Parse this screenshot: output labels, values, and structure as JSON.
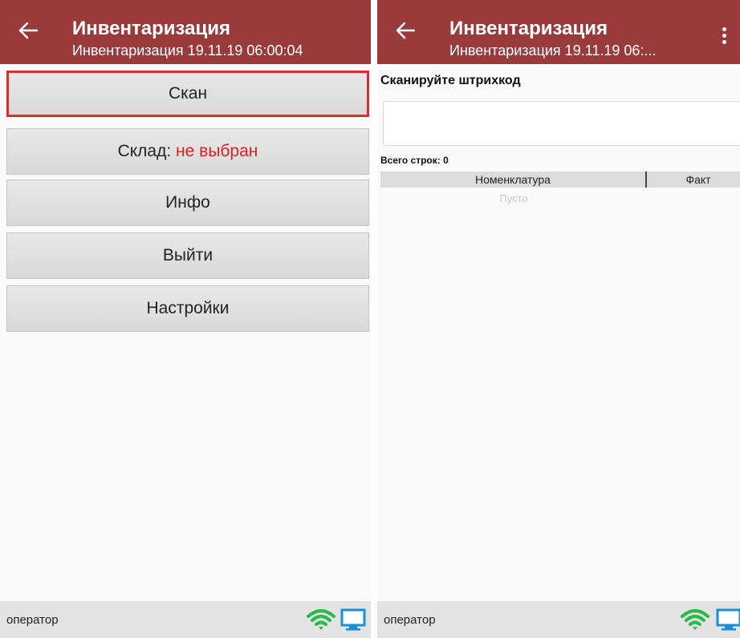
{
  "left_screen": {
    "title": "Инвентаризация",
    "subtitle": "Инвентаризация 19.11.19 06:00:04",
    "buttons": [
      {
        "label": "Скан"
      },
      {
        "label": "Склад:",
        "value": "не выбран"
      },
      {
        "label": "Инфо"
      },
      {
        "label": "Выйти"
      },
      {
        "label": "Настройки"
      }
    ],
    "status_text": "оператор"
  },
  "right_screen": {
    "title": "Инвентаризация",
    "subtitle": "Инвентаризация 19.11.19 06:...",
    "scan_label": "Сканируйте штрихкод",
    "scan_value": "",
    "rows_count": "Всего строк: 0",
    "table": {
      "columns": [
        "Номенклатура",
        "Факт"
      ],
      "empty_text": "Пусто"
    },
    "status_text": "оператор"
  },
  "colors": {
    "appbar": "#9b3a3a",
    "highlight": "#e22b2b",
    "warning_text": "#e02020",
    "wifi": "#2db84a",
    "monitor": "#1a8fd6"
  }
}
